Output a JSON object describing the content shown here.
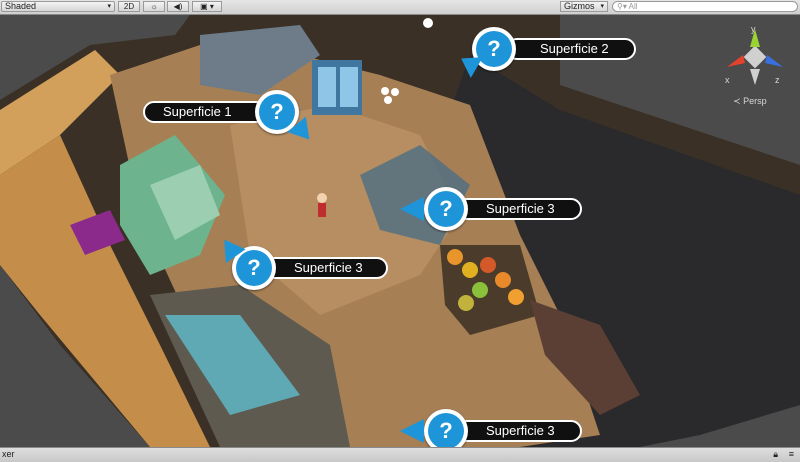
{
  "toolbar": {
    "shading_mode": "Shaded",
    "mode_2d": "2D",
    "lighting_icon": "sun-icon",
    "audio_icon": "speaker-icon",
    "effects_icon": "image-icon",
    "gizmos_label": "Gizmos",
    "search_placeholder": "All"
  },
  "scene_gizmo": {
    "axis_x": "x",
    "axis_y": "y",
    "axis_z": "z",
    "projection_label": "Persp",
    "colors": {
      "x": "#e8412b",
      "y": "#9bd234",
      "z": "#3a6fe0"
    }
  },
  "callouts": [
    {
      "label": "Superficie 2",
      "icon": "question-icon"
    },
    {
      "label": "Superficie 1",
      "icon": "question-icon"
    },
    {
      "label": "Superficie 3",
      "icon": "question-icon"
    },
    {
      "label": "Superficie 3",
      "icon": "question-icon"
    },
    {
      "label": "Superficie 3",
      "icon": "question-icon"
    }
  ],
  "statusbar": {
    "left_text": "xer"
  },
  "colors": {
    "callout_blue": "#1e95d9",
    "callout_dark": "#101010"
  }
}
